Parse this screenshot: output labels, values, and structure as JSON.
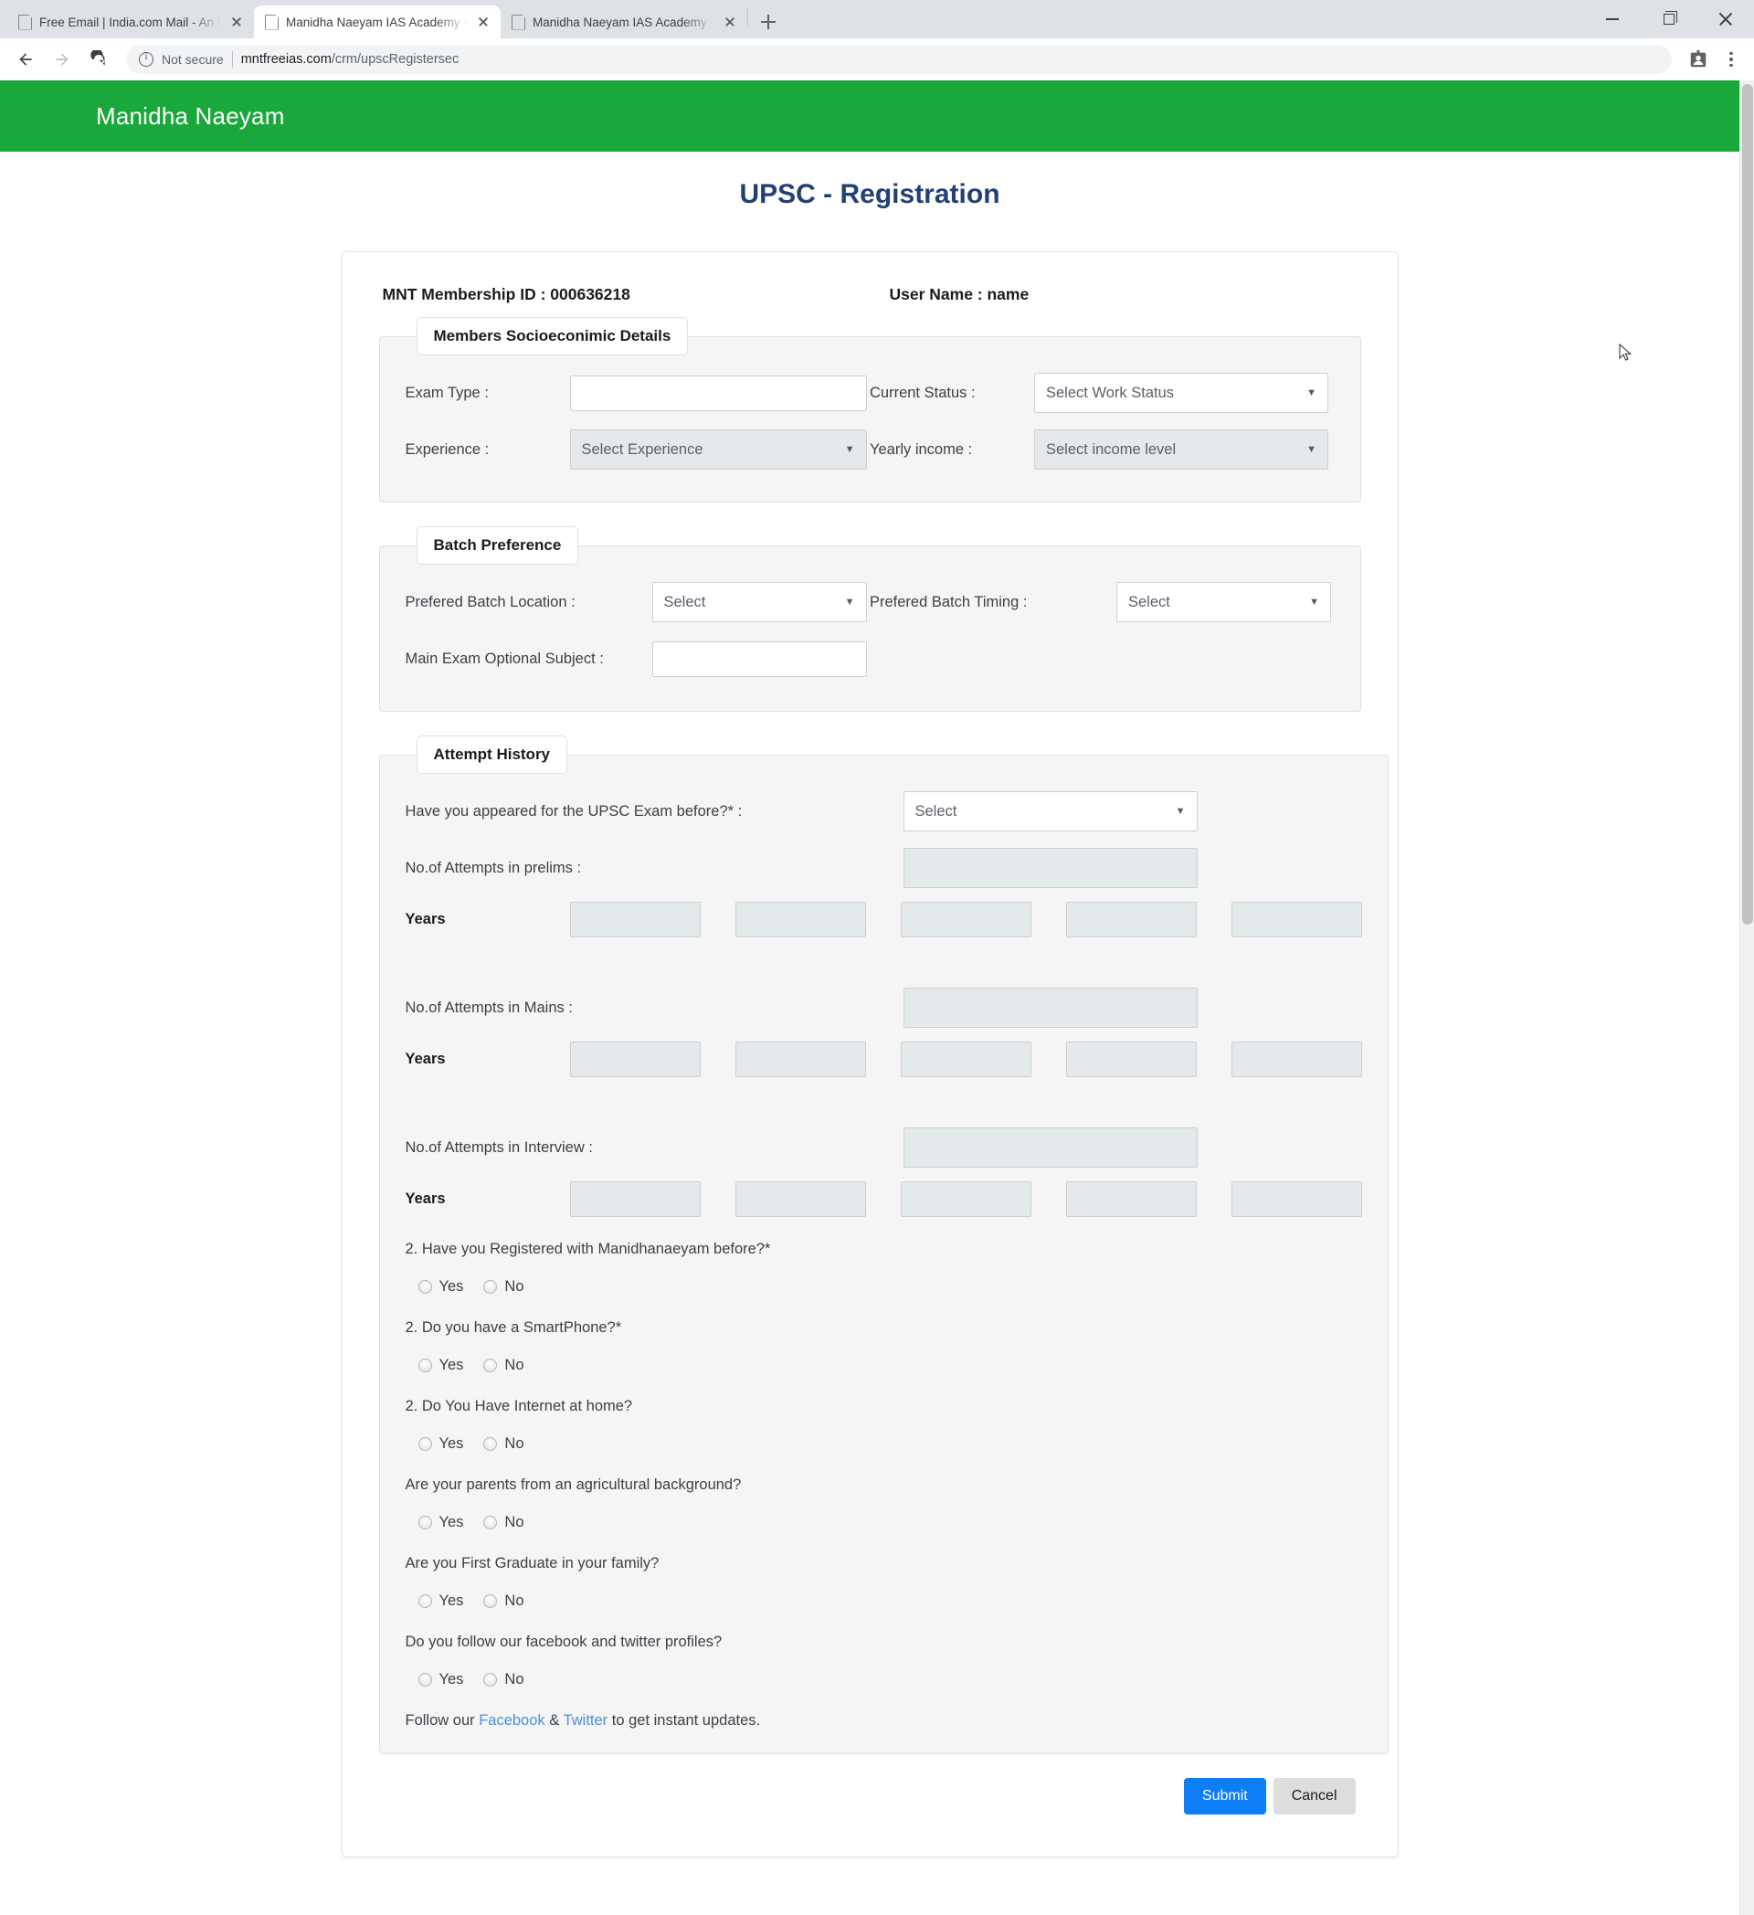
{
  "browser": {
    "tabs": [
      {
        "title": "Free Email | India.com Mail - An E",
        "active": false
      },
      {
        "title": "Manidha Naeyam IAS Academy -",
        "active": true
      },
      {
        "title": "Manidha Naeyam IAS Academy -",
        "active": false
      }
    ],
    "new_tab_label": "+",
    "security_label": "Not secure",
    "url_host": "mntfreeias.com",
    "url_path": "/crm/upscRegistersec",
    "window_controls": {
      "minimize": "minimize",
      "maximize": "maximize",
      "close": "close"
    }
  },
  "site": {
    "brand": "Manidha Naeyam",
    "brand_color": "#1aa83c",
    "page_title": "UPSC - Registration",
    "title_color": "#234075"
  },
  "form": {
    "membership": {
      "label": "MNT Membership ID :",
      "value": "000636218",
      "full": "MNT Membership ID : 000636218"
    },
    "username": {
      "label": "User Name :",
      "value": "name",
      "full": "User Name : name"
    },
    "sections": [
      {
        "legend": "Members Socioeconimic Details",
        "fields": [
          {
            "label": "Exam Type :",
            "type": "text",
            "value": ""
          },
          {
            "label": "Current Status :",
            "type": "select",
            "value": "Select Work Status"
          },
          {
            "label": "Experience :",
            "type": "select",
            "value": "Select Experience"
          },
          {
            "label": "Yearly income :",
            "type": "select",
            "value": "Select income level"
          }
        ]
      },
      {
        "legend": "Batch Preference",
        "fields": [
          {
            "label": "Prefered Batch Location :",
            "type": "select",
            "value": "Select"
          },
          {
            "label": "Prefered Batch Timing :",
            "type": "select",
            "value": "Select"
          },
          {
            "label": "Main Exam Optional Subject :",
            "type": "text",
            "value": ""
          }
        ]
      },
      {
        "legend": "Attempt History",
        "appeared_question": "Have you appeared for the UPSC Exam before?* :",
        "appeared_value": "Select",
        "years_label": "Years",
        "attempt_rows": [
          {
            "label": "No.of Attempts in prelims :",
            "value": "",
            "years": [
              "",
              "",
              "",
              "",
              ""
            ]
          },
          {
            "label": "No.of Attempts in Mains :",
            "value": "",
            "years": [
              "",
              "",
              "",
              "",
              ""
            ]
          },
          {
            "label": "No.of Attempts in Interview :",
            "value": "",
            "years": [
              "",
              "",
              "",
              "",
              ""
            ]
          }
        ],
        "yes_no": {
          "yes": "Yes",
          "no": "No"
        },
        "questions": [
          "2. Have you Registered with Manidhanaeyam before?*",
          "2. Do you have a SmartPhone?*",
          "2. Do You Have Internet at home?",
          "Are your parents from an agricultural background?",
          "Are you First Graduate in your family?",
          "Do you follow our facebook and twitter profiles?"
        ],
        "follow": {
          "prefix": "Follow our ",
          "facebook": "Facebook",
          "middle": " & ",
          "twitter": "Twitter",
          "suffix": " to get instant updates."
        }
      }
    ],
    "buttons": {
      "submit": "Submit",
      "cancel": "Cancel"
    }
  }
}
